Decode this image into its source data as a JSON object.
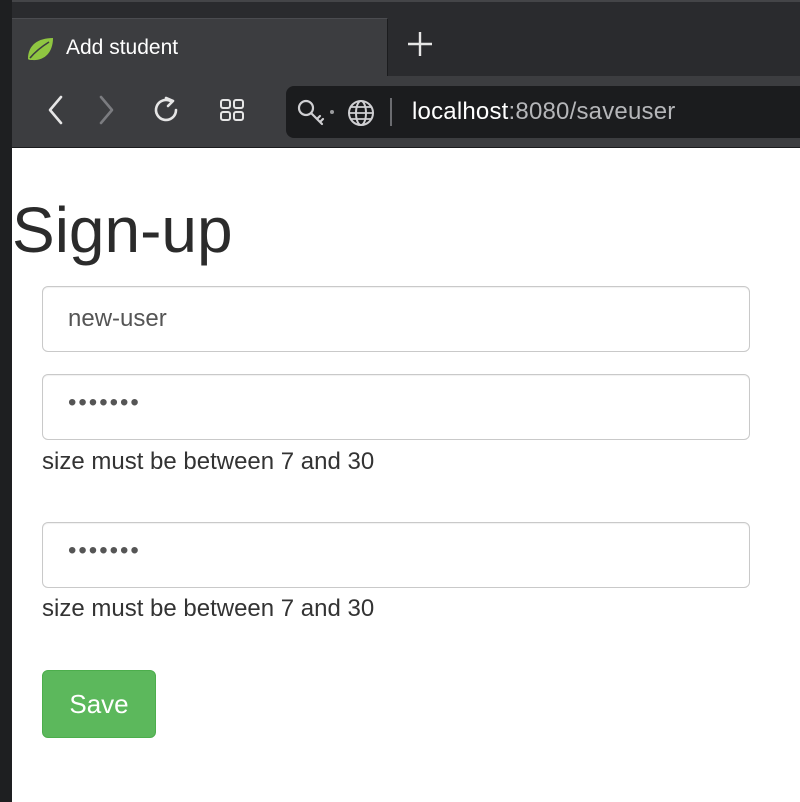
{
  "browser": {
    "tab": {
      "title": "Add student",
      "favicon": "spring-leaf-icon"
    },
    "new_tab_icon": "plus-icon",
    "toolbar": {
      "back_icon": "chevron-left-icon",
      "forward_icon": "chevron-right-icon",
      "reload_icon": "reload-icon",
      "tabs_grid_icon": "grid-icon",
      "key_icon": "key-icon",
      "globe_icon": "globe-icon"
    },
    "url": {
      "host": "localhost",
      "rest": ":8080/saveuser"
    }
  },
  "page": {
    "title": "Sign-up",
    "username": {
      "value": "new-user"
    },
    "password": {
      "value": "•••••••",
      "error": "size must be between 7 and 30"
    },
    "password_check": {
      "value": "•••••••",
      "error": "size must be between 7 and 30"
    },
    "save_label": "Save"
  },
  "colors": {
    "save_button": "#5cb85c",
    "chrome_dark": "#2a2b2e",
    "chrome_toolbar": "#3c3d40",
    "urlbar": "#1b1c1e"
  }
}
